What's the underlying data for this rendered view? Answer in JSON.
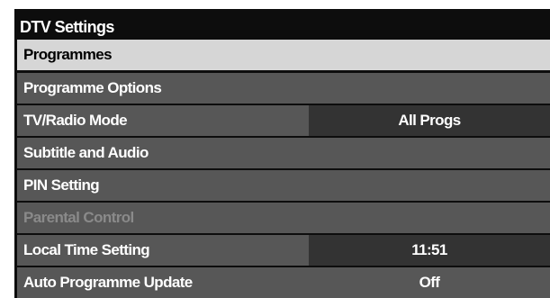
{
  "menu": {
    "title": "DTV Settings",
    "header": "Programmes",
    "items": [
      {
        "label": "Programme Options",
        "value": ""
      },
      {
        "label": "TV/Radio Mode",
        "value": "All Progs"
      },
      {
        "label": "Subtitle and Audio",
        "value": ""
      },
      {
        "label": "PIN Setting",
        "value": ""
      },
      {
        "label": "Parental Control",
        "value": "",
        "disabled": true
      },
      {
        "label": "Local Time Setting",
        "value": "11:51"
      },
      {
        "label": "Auto Programme Update",
        "value": "Off"
      }
    ]
  },
  "colors": {
    "panel": "#0d0d0d",
    "row": "#575757",
    "value_box": "#333333",
    "header_row": "#d6d6d6",
    "disabled_text": "#8a8a8a"
  }
}
